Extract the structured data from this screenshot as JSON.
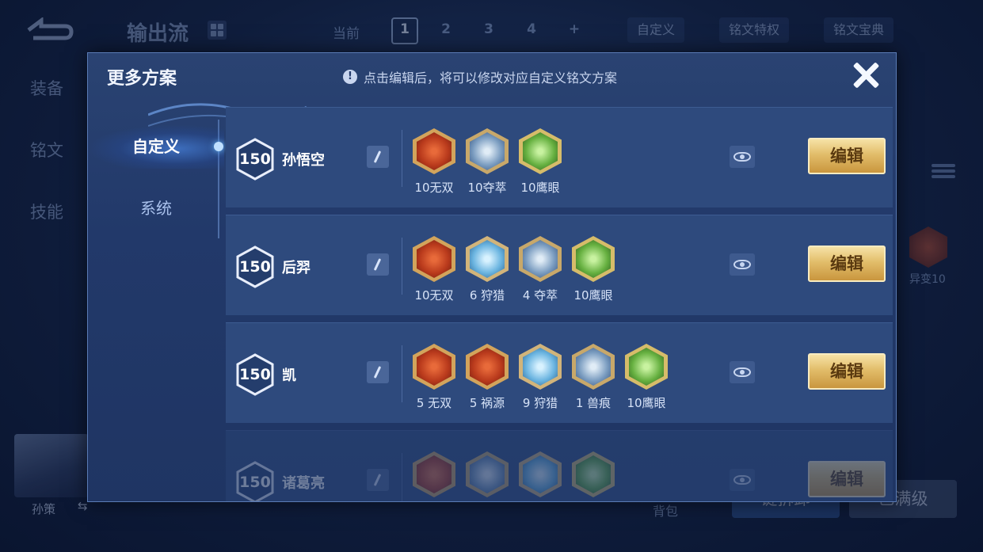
{
  "background": {
    "title": "输出流",
    "current_label": "当前",
    "pages": [
      "1",
      "2",
      "3",
      "4",
      "+"
    ],
    "custom_pill": "自定义",
    "privilege_pill": "铭文特权",
    "codex_pill": "铭文宝典",
    "side_items": [
      "装备",
      "铭文",
      "技能"
    ],
    "hero_name": "孙策",
    "swap_icon": "⇆",
    "bag_label": "背包",
    "btn_disassemble": "键拆卸",
    "btn_maxlevel": "已满级",
    "right_rune_label": "异变10"
  },
  "modal": {
    "title": "更多方案",
    "hint": "点击编辑后，将可以修改对应自定义铭文方案",
    "hint_icon": "!",
    "tabs": [
      "自定义",
      "系统"
    ],
    "edit_label": "编辑",
    "rows": [
      {
        "level": "150",
        "hero": "孙悟空",
        "runes": [
          {
            "label": "10无双",
            "color": "red"
          },
          {
            "label": "10夺萃",
            "color": "steel"
          },
          {
            "label": "10鹰眼",
            "color": "green"
          }
        ]
      },
      {
        "level": "150",
        "hero": "后羿",
        "runes": [
          {
            "label": "10无双",
            "color": "red"
          },
          {
            "label": "6 狩猎",
            "color": "blue"
          },
          {
            "label": "4 夺萃",
            "color": "steel"
          },
          {
            "label": "10鹰眼",
            "color": "green"
          }
        ]
      },
      {
        "level": "150",
        "hero": "凯",
        "runes": [
          {
            "label": "5 无双",
            "color": "red"
          },
          {
            "label": "5 祸源",
            "color": "red"
          },
          {
            "label": "9 狩猎",
            "color": "blue"
          },
          {
            "label": "1 兽痕",
            "color": "steel"
          },
          {
            "label": "10鹰眼",
            "color": "green"
          }
        ]
      },
      {
        "level": "150",
        "hero": "诸葛亮",
        "runes": [
          {
            "label": "",
            "color": "red"
          },
          {
            "label": "",
            "color": "steel"
          },
          {
            "label": "",
            "color": "blue"
          },
          {
            "label": "",
            "color": "green"
          }
        ]
      }
    ]
  },
  "colors": {
    "accent_gold": "#e2bd6a",
    "panel_blue": "#2e4a7d",
    "modal_blue": "#22396a"
  }
}
